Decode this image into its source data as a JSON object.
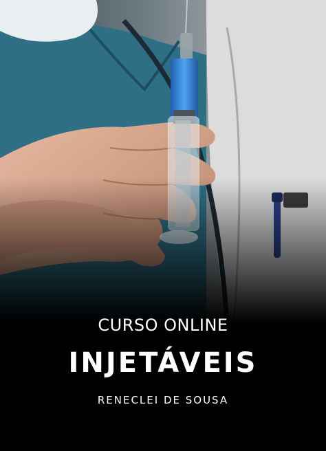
{
  "course": {
    "subtitle": "CURSO ONLINE",
    "title": "INJETÁVEIS",
    "author": "RENECLEI DE SOUSA"
  },
  "image": {
    "icon": "syringe-in-hand-photo",
    "colors": {
      "background": "#000000",
      "scrubs": "#2f6f86",
      "syringe_fluid": "#2f7fd0",
      "skin": "#d9a88e",
      "coat": "#d8d8d8"
    }
  }
}
